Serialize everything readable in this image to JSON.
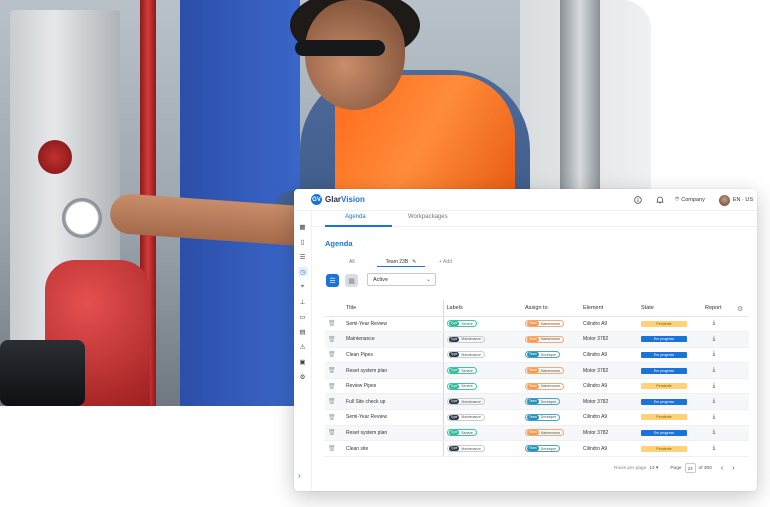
{
  "app": {
    "logo_initials": "GV",
    "brand_part1": "Glar",
    "brand_part2": "Vision",
    "company_label": "Company",
    "language_label": "EN · US"
  },
  "tabs": [
    {
      "label": "Agenda",
      "active": true
    },
    {
      "label": "Workpackages",
      "active": false
    }
  ],
  "page_title": "Agenda",
  "filters": {
    "all_label": "All",
    "team_label": "Team 23B",
    "add_label": "+ Add",
    "status_select": "Active"
  },
  "table": {
    "columns": [
      "Title",
      "Labels",
      "Assign to",
      "Element",
      "State",
      "Report"
    ],
    "rows": [
      {
        "title": "Semi-Year Review",
        "label_type": "Type",
        "label": "Service",
        "label_style": "green",
        "assign_type": "Team",
        "assign": "Maintenance",
        "assign_style": "orange",
        "element": "Cilindro A9",
        "state": "Pendente",
        "state_style": "pending"
      },
      {
        "title": "Maintenance",
        "label_type": "Type",
        "label": "Maintenance",
        "label_style": "dark",
        "assign_type": "Team",
        "assign": "Maintenance",
        "assign_style": "orange",
        "element": "Motor 3782",
        "state": "Em progress",
        "state_style": "progress"
      },
      {
        "title": "Clean Pipes",
        "label_type": "Type",
        "label": "Maintenance",
        "label_style": "dark",
        "assign_type": "Team",
        "assign": "Developer",
        "assign_style": "teal",
        "element": "Cilindro A9",
        "state": "Em progress",
        "state_style": "progress"
      },
      {
        "title": "Reset system plan",
        "label_type": "Type",
        "label": "Service",
        "label_style": "green",
        "assign_type": "Team",
        "assign": "Maintenance",
        "assign_style": "orange",
        "element": "Motor 3782",
        "state": "Em progress",
        "state_style": "progress"
      },
      {
        "title": "Review Pipes",
        "label_type": "Type",
        "label": "Service",
        "label_style": "green",
        "assign_type": "Team",
        "assign": "Maintenance",
        "assign_style": "orange",
        "element": "Cilindro A9",
        "state": "Pendente",
        "state_style": "pending"
      },
      {
        "title": "Full Site check up",
        "label_type": "Type",
        "label": "Maintenance",
        "label_style": "dark",
        "assign_type": "Team",
        "assign": "Developer",
        "assign_style": "teal",
        "element": "Motor 3782",
        "state": "Em progress",
        "state_style": "progress"
      },
      {
        "title": "Semi-Year Review",
        "label_type": "Type",
        "label": "Maintenance",
        "label_style": "dark",
        "assign_type": "Team",
        "assign": "Developer",
        "assign_style": "teal",
        "element": "Cilindro A9",
        "state": "Pendente",
        "state_style": "pending"
      },
      {
        "title": "Reset system plan",
        "label_type": "Type",
        "label": "Service",
        "label_style": "green",
        "assign_type": "Team",
        "assign": "Maintenance",
        "assign_style": "orange",
        "element": "Motor 3782",
        "state": "Em progress",
        "state_style": "progress"
      },
      {
        "title": "Clean site",
        "label_type": "Type",
        "label": "Maintenance",
        "label_style": "dark",
        "assign_type": "Team",
        "assign": "Developer",
        "assign_style": "teal",
        "element": "Cilindro A9",
        "state": "Pendente",
        "state_style": "pending"
      }
    ]
  },
  "pagination": {
    "rows_per_page_label": "Rows per page",
    "rows_per_page_value": "13 ▾",
    "page_label": "Page",
    "current_page": "23",
    "of_label": "of 300",
    "prev_icon": "‹",
    "next_icon": "›"
  },
  "icons": {
    "sidenav": [
      "dashboard-icon",
      "document-icon",
      "checklist-icon",
      "clock-icon",
      "location-icon",
      "org-chart-icon",
      "book-icon",
      "clipboard-icon",
      "warning-icon",
      "calendar-icon",
      "settings-icon"
    ],
    "topbar": [
      "info-icon",
      "bell-icon"
    ]
  },
  "colors": {
    "accent": "#1a73d9",
    "pending": "#ffd27a",
    "progress": "#1a73d9",
    "service_tag": "#2eb894",
    "maintenance_team": "#f29b55",
    "developer_team": "#2b8fb5"
  }
}
